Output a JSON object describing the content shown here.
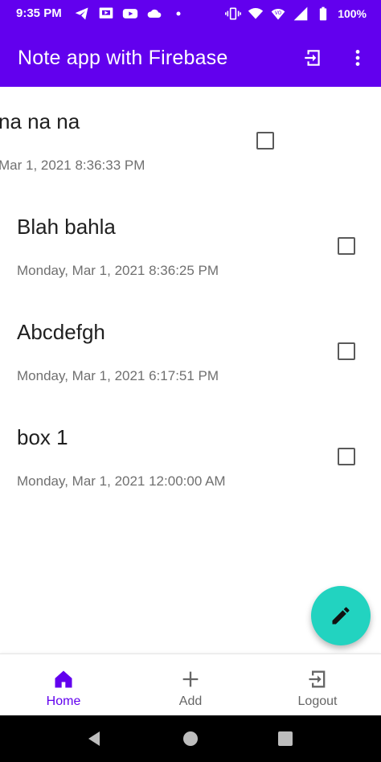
{
  "status_bar": {
    "time": "9:35 PM",
    "battery": "100%",
    "left_icons": [
      "telegram-icon",
      "screen-icon",
      "youtube-icon",
      "cloud-icon",
      "dot-icon"
    ],
    "right_icons": [
      "vibrate-icon",
      "wifi-icon",
      "volte-icon",
      "signal-icon",
      "battery-icon"
    ]
  },
  "app_bar": {
    "title": "Note app with Firebase",
    "actions": [
      "logout-icon",
      "more-vert-icon"
    ],
    "color": "#6200EE"
  },
  "notes": [
    {
      "title": "na na na",
      "date": "Mar 1, 2021 8:36:33 PM",
      "checked": false
    },
    {
      "title": "Blah bahla",
      "date": "Monday, Mar 1, 2021 8:36:25 PM",
      "checked": false
    },
    {
      "title": "Abcdefgh",
      "date": "Monday, Mar 1, 2021 6:17:51 PM",
      "checked": false
    },
    {
      "title": "box 1",
      "date": "Monday, Mar 1, 2021 12:00:00 AM",
      "checked": false
    }
  ],
  "fab": {
    "icon": "edit-pencil-icon",
    "color": "#22D3C0"
  },
  "bottom_nav": {
    "items": [
      {
        "label": "Home",
        "icon": "home-icon",
        "active": true
      },
      {
        "label": "Add",
        "icon": "add-icon",
        "active": false
      },
      {
        "label": "Logout",
        "icon": "logout-icon",
        "active": false
      }
    ]
  },
  "system_nav": [
    "back-icon",
    "home-circle-icon",
    "recents-icon"
  ]
}
